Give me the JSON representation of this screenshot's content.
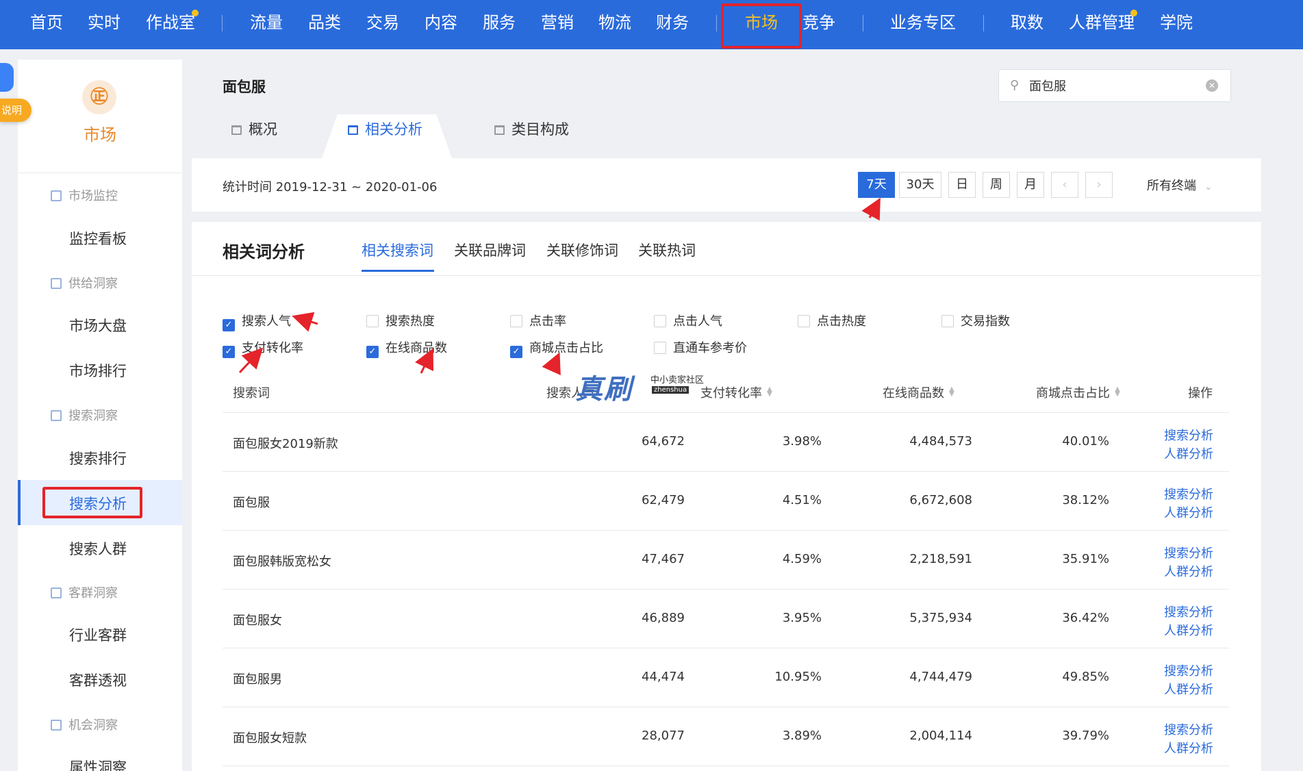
{
  "top_nav": {
    "items": [
      "首页",
      "实时",
      "作战室",
      "流量",
      "品类",
      "交易",
      "内容",
      "服务",
      "营销",
      "物流",
      "财务",
      "市场",
      "竞争",
      "业务专区",
      "取数",
      "人群管理",
      "学院"
    ]
  },
  "sidebar": {
    "help_label": "说明",
    "logo_glyph": "㊣",
    "title": "市场",
    "groups": [
      {
        "label": "市场监控",
        "items": [
          "监控看板"
        ]
      },
      {
        "label": "供给洞察",
        "items": [
          "市场大盘",
          "市场排行"
        ]
      },
      {
        "label": "搜索洞察",
        "items": [
          "搜索排行",
          "搜索分析",
          "搜索人群"
        ]
      },
      {
        "label": "客群洞察",
        "items": [
          "行业客群",
          "客群透视"
        ]
      },
      {
        "label": "机会洞察",
        "items": [
          "属性洞察"
        ]
      }
    ],
    "active_item": "搜索分析"
  },
  "header": {
    "title": "面包服",
    "search_value": "面包服",
    "tabs": [
      "概况",
      "相关分析",
      "类目构成"
    ],
    "active_tab": "相关分析",
    "stat_time": "统计时间 2019-12-31 ~ 2020-01-06",
    "periods": [
      "7天",
      "30天",
      "日",
      "周",
      "月"
    ],
    "active_period": "7天",
    "terminal": "所有终端"
  },
  "analysis": {
    "title": "相关词分析",
    "tabs": [
      "相关搜索词",
      "关联品牌词",
      "关联修饰词",
      "关联热词"
    ],
    "active_tab": "相关搜索词",
    "metrics": [
      {
        "label": "搜索人气",
        "checked": true
      },
      {
        "label": "搜索热度",
        "checked": false
      },
      {
        "label": "点击率",
        "checked": false
      },
      {
        "label": "点击人气",
        "checked": false
      },
      {
        "label": "点击热度",
        "checked": false
      },
      {
        "label": "交易指数",
        "checked": false
      },
      {
        "label": "支付转化率",
        "checked": true
      },
      {
        "label": "在线商品数",
        "checked": true
      },
      {
        "label": "商城点击占比",
        "checked": true
      },
      {
        "label": "直通车参考价",
        "checked": false
      }
    ],
    "columns": [
      "搜索词",
      "搜索人气",
      "支付转化率",
      "在线商品数",
      "商城点击占比",
      "操作"
    ],
    "rows": [
      {
        "keyword": "面包服女2019新款",
        "popularity": "64,672",
        "conversion": "3.98%",
        "online_items": "4,484,573",
        "mall_click": "40.01%"
      },
      {
        "keyword": "面包服",
        "popularity": "62,479",
        "conversion": "4.51%",
        "online_items": "6,672,608",
        "mall_click": "38.12%"
      },
      {
        "keyword": "面包服韩版宽松女",
        "popularity": "47,467",
        "conversion": "4.59%",
        "online_items": "2,218,591",
        "mall_click": "35.91%"
      },
      {
        "keyword": "面包服女",
        "popularity": "46,889",
        "conversion": "3.95%",
        "online_items": "5,375,934",
        "mall_click": "36.42%"
      },
      {
        "keyword": "面包服男",
        "popularity": "44,474",
        "conversion": "10.95%",
        "online_items": "4,744,479",
        "mall_click": "49.85%"
      },
      {
        "keyword": "面包服女短款",
        "popularity": "28,077",
        "conversion": "3.89%",
        "online_items": "2,004,114",
        "mall_click": "39.79%"
      }
    ],
    "row_actions": [
      "搜索分析",
      "人群分析"
    ]
  },
  "watermark": {
    "main": "真刷",
    "sub": "中小卖家社区",
    "tag": "zhenshua"
  },
  "colors": {
    "nav_blue": "#2a6bdc",
    "highlight_red": "#e5232a",
    "accent_orange": "#e88a2b",
    "link_blue": "#2a6bdc"
  }
}
